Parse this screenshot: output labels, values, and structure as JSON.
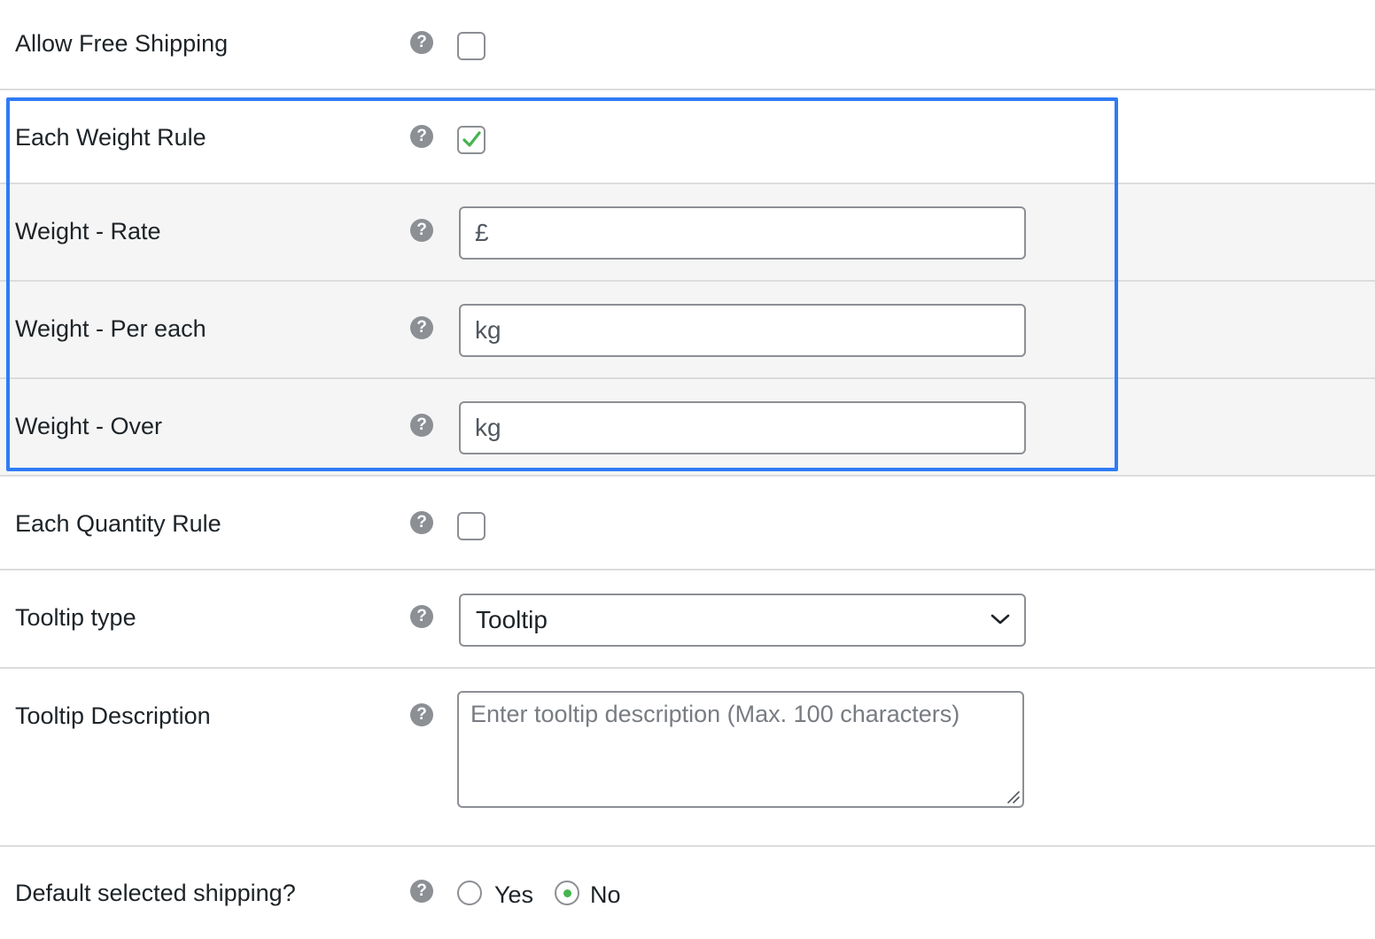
{
  "fields": {
    "allow_free_shipping": {
      "label": "Allow Free Shipping",
      "checked": false
    },
    "each_weight_rule": {
      "label": "Each Weight Rule",
      "checked": true
    },
    "weight_rate": {
      "label": "Weight - Rate",
      "prefix": "£"
    },
    "weight_per_each": {
      "label": "Weight - Per each",
      "unit": "kg"
    },
    "weight_over": {
      "label": "Weight - Over",
      "unit": "kg"
    },
    "each_quantity_rule": {
      "label": "Each Quantity Rule",
      "checked": false
    },
    "tooltip_type": {
      "label": "Tooltip type",
      "selected": "Tooltip"
    },
    "tooltip_description": {
      "label": "Tooltip Description",
      "placeholder": "Enter tooltip description (Max. 100 characters)"
    },
    "default_selected_shipping": {
      "label": "Default selected shipping?",
      "options": [
        "Yes",
        "No"
      ],
      "selected": "No"
    }
  },
  "help_icon_glyph": "?",
  "colors": {
    "highlight": "#2f7bf5",
    "checkmark": "#46b450",
    "shaded_row": "#f5f5f5",
    "border": "#8c8f94"
  }
}
